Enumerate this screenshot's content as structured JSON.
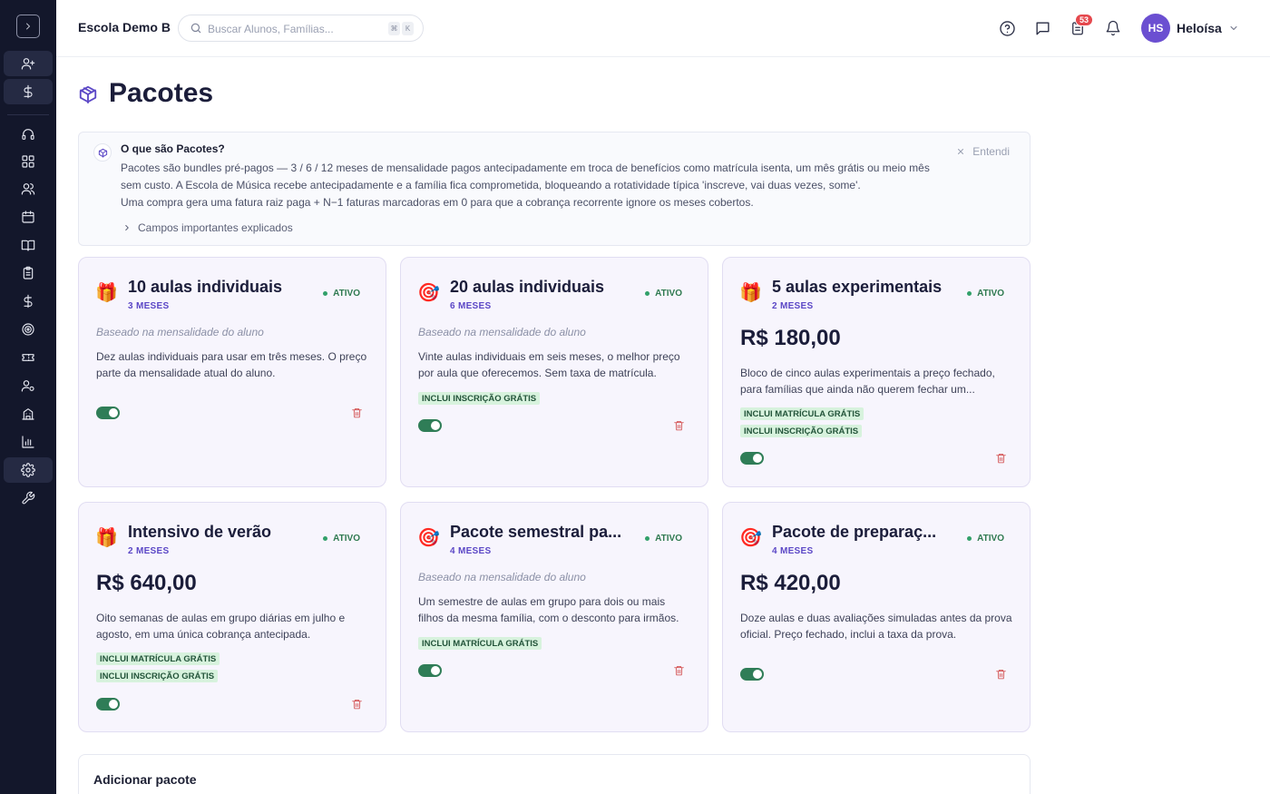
{
  "header": {
    "school_name": "Escola Demo B",
    "search_placeholder": "Buscar Alunos, Famílias...",
    "search_shortcut": [
      "⌘",
      "K"
    ],
    "tasks_badge": "53",
    "user_initials": "HS",
    "user_name": "Heloísa"
  },
  "sidebar": {
    "icons": [
      "user-plus-icon",
      "dollar-icon",
      "headset-icon",
      "dashboard-icon",
      "users-icon",
      "calendar-icon",
      "book-icon",
      "clipboard-icon",
      "dollar-icon",
      "target-icon",
      "ticket-icon",
      "user-settings-icon",
      "building-icon",
      "bar-chart-icon",
      "gear-icon",
      "wrench-icon"
    ],
    "active": [
      "user-plus-icon",
      "dollar-icon",
      "gear-icon"
    ]
  },
  "page": {
    "title": "Pacotes"
  },
  "info": {
    "title": "O que são Pacotes?",
    "line1": "Pacotes são bundles pré-pagos — 3 / 6 / 12 meses de mensalidade pagos antecipadamente em troca de benefícios como matrícula isenta, um mês grátis ou meio mês sem custo. A Escola de Música recebe antecipadamente e a família fica comprometida, bloqueando a rotatividade típica 'inscreve, vai duas vezes, some'.",
    "line2": "Uma compra gera uma fatura raiz paga + N−1 faturas marcadoras em 0 para que a cobrança recorrente ignore os meses cobertos.",
    "more_label": "Campos importantes explicados",
    "dismiss_label": "Entendi"
  },
  "packages": [
    {
      "icon": "🎁",
      "title": "10 aulas individuais",
      "duration": "3 MESES",
      "status": "ATIVO",
      "basis": "Baseado na mensalidade do aluno",
      "price": "",
      "description": "Dez aulas individuais para usar em três meses. O preço parte da mensalidade atual do aluno.",
      "tags": [],
      "active": true
    },
    {
      "icon": "🎯",
      "title": "20 aulas individuais",
      "duration": "6 MESES",
      "status": "ATIVO",
      "basis": "Baseado na mensalidade do aluno",
      "price": "",
      "description": "Vinte aulas individuais em seis meses, o melhor preço por aula que oferecemos. Sem taxa de matrícula.",
      "tags": [
        "INCLUI INSCRIÇÃO GRÁTIS"
      ],
      "active": true
    },
    {
      "icon": "🎁",
      "title": "5 aulas experimentais",
      "duration": "2 MESES",
      "status": "ATIVO",
      "basis": "",
      "price": "R$ 180,00",
      "description": "Bloco de cinco aulas experimentais a preço fechado, para famílias que ainda não querem fechar um...",
      "tags": [
        "INCLUI MATRÍCULA GRÁTIS",
        "INCLUI INSCRIÇÃO GRÁTIS"
      ],
      "active": true
    },
    {
      "icon": "🎁",
      "title": "Intensivo de verão",
      "duration": "2 MESES",
      "status": "ATIVO",
      "basis": "",
      "price": "R$ 640,00",
      "description": "Oito semanas de aulas em grupo diárias em julho e agosto, em uma única cobrança antecipada.",
      "tags": [
        "INCLUI MATRÍCULA GRÁTIS",
        "INCLUI INSCRIÇÃO GRÁTIS"
      ],
      "active": true
    },
    {
      "icon": "🎯",
      "title": "Pacote semestral pa...",
      "duration": "4 MESES",
      "status": "ATIVO",
      "basis": "Baseado na mensalidade do aluno",
      "price": "",
      "description": "Um semestre de aulas em grupo para dois ou mais filhos da mesma família, com o desconto para irmãos.",
      "tags": [
        "INCLUI MATRÍCULA GRÁTIS"
      ],
      "active": true
    },
    {
      "icon": "🎯",
      "title": "Pacote de preparaç...",
      "duration": "4 MESES",
      "status": "ATIVO",
      "basis": "",
      "price": "R$ 420,00",
      "description": "Doze aulas e duas avaliações simuladas antes da prova oficial. Preço fechado, inclui a taxa da prova.",
      "tags": [],
      "active": true
    }
  ],
  "add_panel": {
    "title": "Adicionar pacote"
  },
  "colors": {
    "sidebar_bg": "#13172b",
    "accent": "#5b47c6",
    "status_green": "#32a06a",
    "toggle_on": "#2f7d57",
    "tag_bg": "#d7f2dd",
    "delete_red": "#d04545",
    "card_bg": "#f7f5fd"
  }
}
